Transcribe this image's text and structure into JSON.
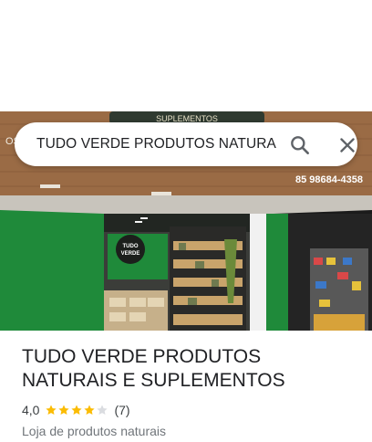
{
  "search": {
    "query": "TUDO VERDE PRODUTOS NATURAIS"
  },
  "photo": {
    "sign_text": "SUPLEMENTOS",
    "sign_logo": "VERDE",
    "phone": "85 98684-4358",
    "inner_logo_top": "TUDO",
    "inner_logo_bottom": "VERDE",
    "left_edge_text": "OS"
  },
  "place": {
    "title": "TUDO VERDE PRODUTOS NATURAIS E SUPLEMENTOS",
    "rating": "4,0",
    "rating_numeric": 4.0,
    "stars_max": 5,
    "review_count": "(7)",
    "category": "Loja de produtos naturais"
  },
  "icons": {
    "search": "search-icon",
    "close": "close-icon",
    "star": "star-icon"
  },
  "colors": {
    "star_filled": "#fbbc04",
    "star_empty": "#dadce0",
    "store_green": "#1f8a3a"
  }
}
